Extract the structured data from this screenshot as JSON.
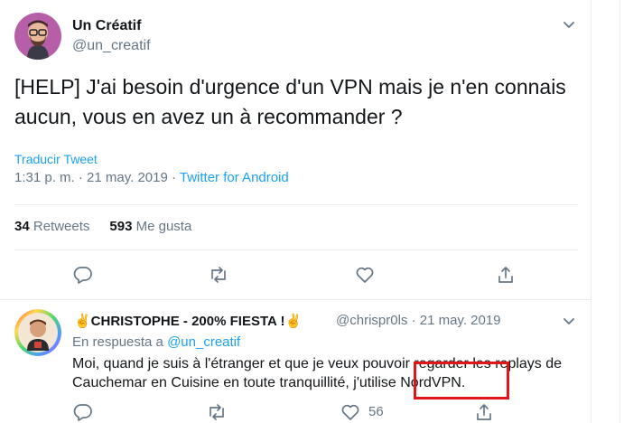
{
  "tweet": {
    "display_name": "Un Créatif",
    "handle": "@un_creatif",
    "text": "[HELP] J'ai besoin d'urgence d'un VPN mais je n'en connais aucun, vous en avez un à recommander ?",
    "translate_label": "Traducir Tweet",
    "time": "1:31 p. m. · 21 may. 2019 · ",
    "source": "Twitter for Android",
    "retweets_count": "34",
    "retweets_label": "Retweets",
    "likes_count": "593",
    "likes_label": "Me gusta",
    "avatar_icon": "avatar-bearded-man-glasses",
    "actions": [
      "reply-icon",
      "retweet-icon",
      "like-icon",
      "share-icon"
    ]
  },
  "reply": {
    "display_name": "✌️CHRISTOPHE - 200% FIESTA !✌️",
    "handle_date": "@chrispr0ls · 21 may. 2019",
    "in_reply_prefix": "En respuesta a ",
    "in_reply_mention": "@un_creatif",
    "text": "Moi, quand je suis à l'étranger et que je veux pouvoir regarder les replays de Cauchemar en Cuisine en toute tranquillité, j'utilise NordVPN.",
    "likes_count": "56",
    "avatar_icon": "avatar-man-rainbow-ring"
  },
  "colors": {
    "link_blue": "#1da1f2",
    "secondary_text": "#657786",
    "divider": "#e6ecf0",
    "highlight_red": "#e0161b"
  }
}
